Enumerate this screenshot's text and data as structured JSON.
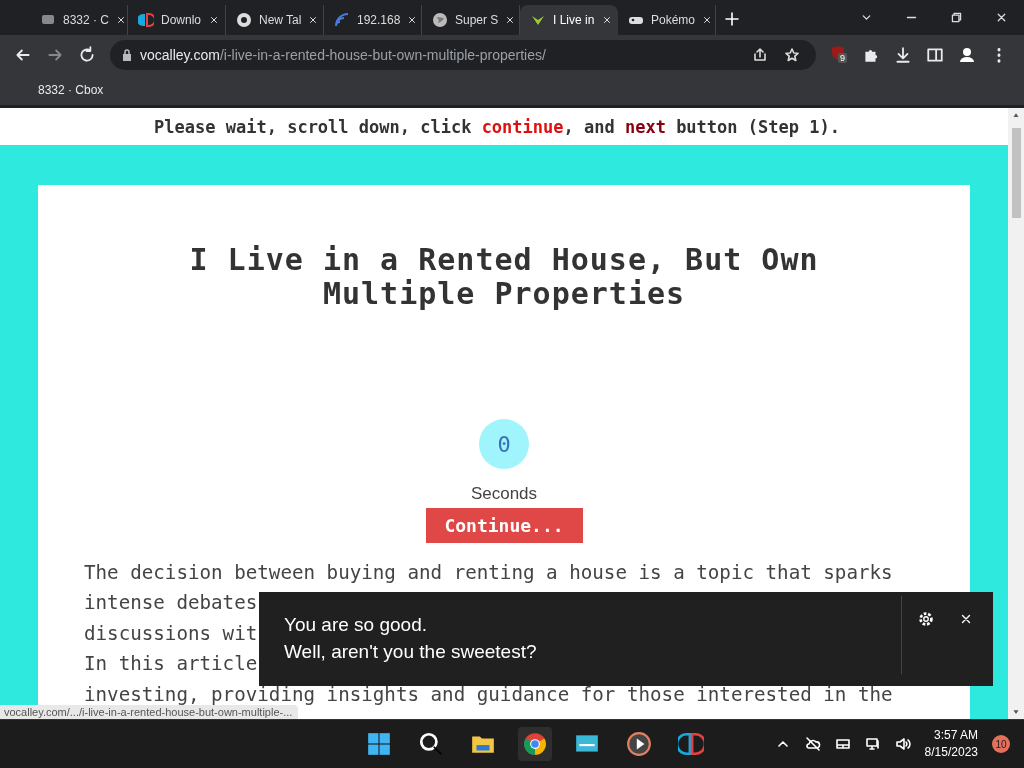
{
  "tabs": [
    {
      "title": "8332 · C",
      "selected": false
    },
    {
      "title": "Downlo",
      "selected": false
    },
    {
      "title": "New Tal",
      "selected": false
    },
    {
      "title": "192.168",
      "selected": false
    },
    {
      "title": "Super S",
      "selected": false
    },
    {
      "title": "I Live in",
      "selected": true
    },
    {
      "title": "Pokémo",
      "selected": false
    }
  ],
  "address": {
    "domain": "vocalley.com",
    "path": "/i-live-in-a-rented-house-but-own-multiple-properties/"
  },
  "extension_badge": "9",
  "bookmarks": [
    "8332 · Cbox"
  ],
  "notice": [
    {
      "text": "Please wait, scroll down, click ",
      "color": "#333333"
    },
    {
      "text": "continue",
      "color": "#e01010"
    },
    {
      "text": ", and ",
      "color": "#333333"
    },
    {
      "text": "next",
      "color": "#8a0010"
    },
    {
      "text": " button (Step 1).",
      "color": "#333333"
    }
  ],
  "article": {
    "title": "I Live in a Rented House, But Own Multiple Properties",
    "counter": "0",
    "counter_label": "Seconds",
    "button": "Continue...",
    "lines": [
      "The decision between buying and renting a house is a topic that sparks",
      "intense debates",
      "discussions wit",
      "In this article",
      "investing, providing insights and guidance for those interested in the"
    ]
  },
  "status_url": "vocalley.com/.../i-live-in-a-rented-house-but-own-multiple-...",
  "captions": [
    "You are so good.",
    "Well, aren't you the sweetest?"
  ],
  "taskbar": {
    "time": "3:57 AM",
    "date": "8/15/2023",
    "notifications": "10"
  }
}
